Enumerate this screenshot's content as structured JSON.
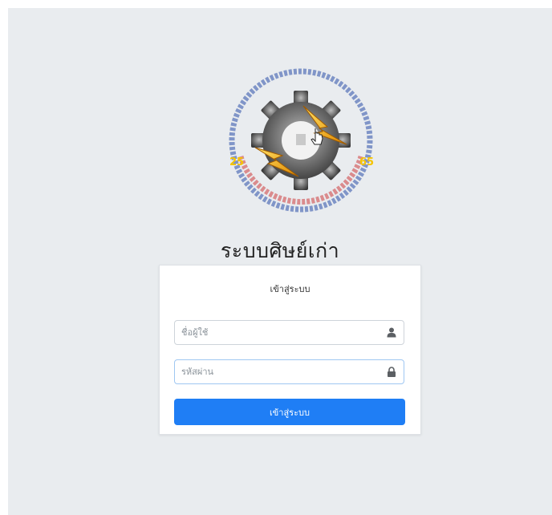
{
  "app": {
    "title": "ระบบศิษย์เก่า"
  },
  "logo": {
    "year_left": "25",
    "year_right": "65"
  },
  "login": {
    "header": "เข้าสู่ระบบ",
    "username_placeholder": "ชื่อผู้ใช้",
    "username_value": "",
    "password_placeholder": "รหัสผ่าน",
    "password_value": "",
    "submit_label": "เข้าสู่ระบบ",
    "user_icon": "user-icon",
    "lock_icon": "lock-icon"
  },
  "colors": {
    "background": "#e9ecef",
    "primary": "#1f7ef5",
    "card": "#ffffff"
  }
}
